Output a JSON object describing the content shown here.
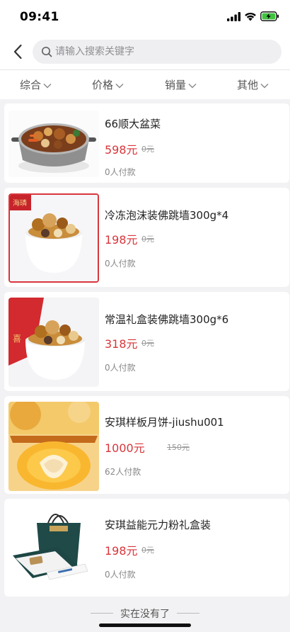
{
  "status_bar": {
    "time": "09:41"
  },
  "header": {
    "search_placeholder": "请输入搜索关键字"
  },
  "sort_tabs": [
    {
      "label": "综合"
    },
    {
      "label": "价格"
    },
    {
      "label": "销量"
    },
    {
      "label": "其他"
    }
  ],
  "products": [
    {
      "name": "66顺大盆菜",
      "price": "598元",
      "original_price": "0元",
      "sales": "0人付款"
    },
    {
      "name": "冷冻泡沫装佛跳墙300g*4",
      "price": "198元",
      "original_price": "0元",
      "sales": "0人付款"
    },
    {
      "name": "常温礼盒装佛跳墙300g*6",
      "price": "318元",
      "original_price": "0元",
      "sales": "0人付款"
    },
    {
      "name": "安琪样板月饼-jiushu001",
      "price": "1000元",
      "original_price": "150元",
      "sales": "62人付款"
    },
    {
      "name": "安琪益能元力粉礼盒装",
      "price": "198元",
      "original_price": "0元",
      "sales": "0人付款"
    }
  ],
  "footer": {
    "end_text": "实在没有了"
  },
  "colors": {
    "price": "#d8363b",
    "background": "#f2f2f4",
    "battery": "#3fc33f"
  }
}
